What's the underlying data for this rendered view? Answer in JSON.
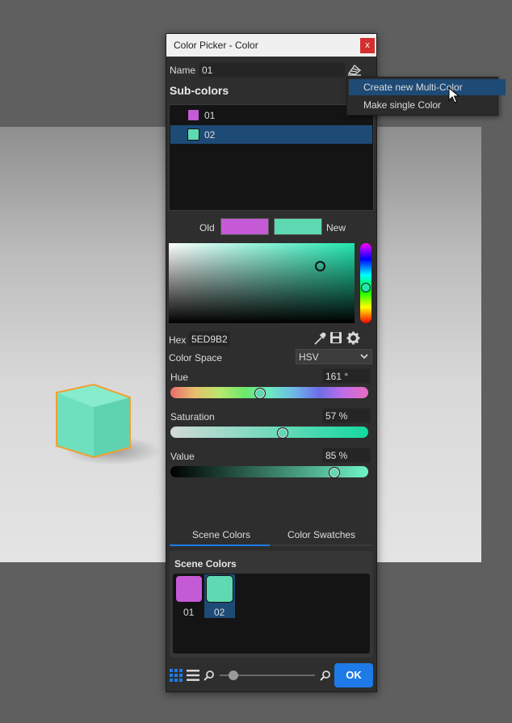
{
  "dialog": {
    "title": "Color Picker - Color",
    "close_label": "x",
    "name_label": "Name",
    "name_value": "01",
    "subcolors_heading": "Sub-colors",
    "subcolors": [
      {
        "label": "01",
        "color": "#c45ad6",
        "selected": false
      },
      {
        "label": "02",
        "color": "#5ed9b2",
        "selected": true
      }
    ],
    "old_label": "Old",
    "new_label": "New",
    "old_color": "#c45ad6",
    "new_color": "#5ed9b2",
    "hex_label": "Hex",
    "hex_value": "5ED9B2",
    "color_space_label": "Color Space",
    "color_space_value": "HSV",
    "sliders": [
      {
        "label": "Hue",
        "value_text": "161 °",
        "fraction": 0.45
      },
      {
        "label": "Saturation",
        "value_text": "57 %",
        "fraction": 0.57
      },
      {
        "label": "Value",
        "value_text": "85 %",
        "fraction": 0.85
      }
    ],
    "tabs": [
      {
        "label": "Scene Colors",
        "active": true
      },
      {
        "label": "Color Swatches",
        "active": false
      }
    ],
    "scene_colors_heading": "Scene Colors",
    "scene_swatches": [
      {
        "label": "01",
        "color": "#c45ad6",
        "selected": false
      },
      {
        "label": "02",
        "color": "#5ed9b2",
        "selected": true
      }
    ],
    "ok_label": "OK",
    "zoom_fraction": 0.1
  },
  "context_menu": {
    "items": [
      {
        "label": "Create new Multi-Color",
        "highlighted": true
      },
      {
        "label": "Make single Color",
        "highlighted": false
      }
    ]
  },
  "colors": {
    "accent": "#1e7ae6",
    "cube": "#6ee0bd",
    "cube_outline": "#f0a030"
  }
}
